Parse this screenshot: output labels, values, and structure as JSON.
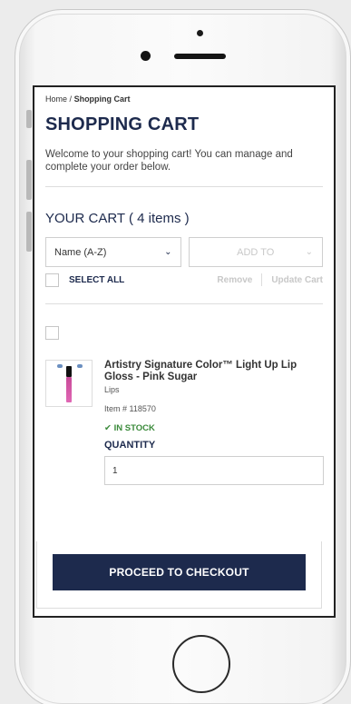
{
  "breadcrumb": {
    "home": "Home",
    "separator": "/",
    "current": "Shopping Cart"
  },
  "page_title": "SHOPPING CART",
  "welcome_text": "Welcome to your shopping cart! You can manage and complete your order below.",
  "cart": {
    "heading": "YOUR CART ( 4 items )",
    "sort_select": "Name (A-Z)",
    "add_to_select": "ADD TO",
    "select_all": "SELECT ALL",
    "remove": "Remove",
    "update_cart": "Update Cart"
  },
  "items": [
    {
      "name": "Artistry Signature Color™ Light Up Lip Gloss - Pink Sugar",
      "category": "Lips",
      "sku": "Item # 118570",
      "stock": "IN STOCK",
      "quantity_label": "QUANTITY",
      "quantity": "1"
    }
  ],
  "checkout_button": "PROCEED TO CHECKOUT",
  "icons": {
    "chevron": "chevron-down-icon",
    "check": "checkmark-icon"
  },
  "colors": {
    "brand_navy": "#1d2a4d",
    "in_stock_green": "#3a8a3a",
    "disabled_gray": "#c8c8c8"
  }
}
